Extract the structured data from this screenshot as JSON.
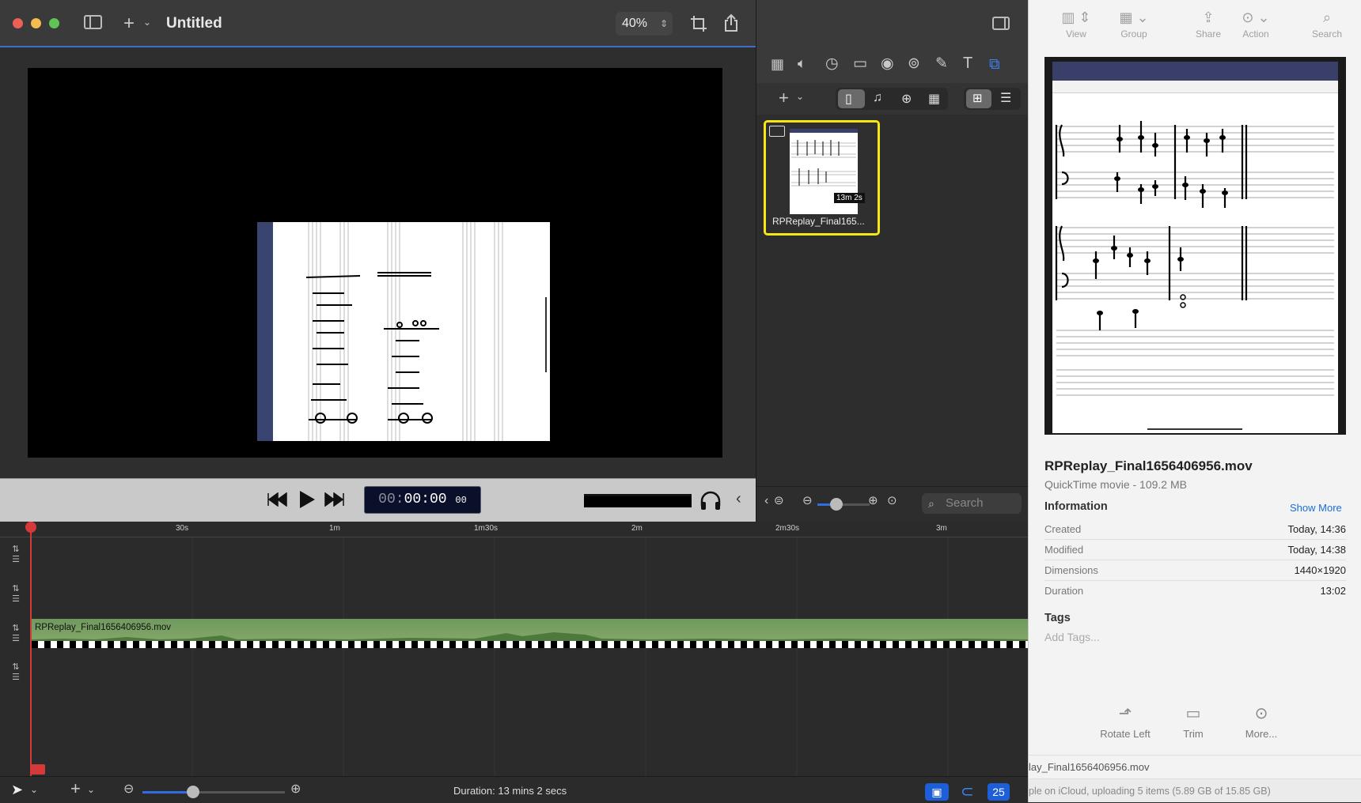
{
  "editor": {
    "title": "Untitled",
    "zoom": "40%",
    "timecode": {
      "dim": "00:",
      "main": "00:00",
      "frames": "00"
    },
    "icons": [
      "close-button",
      "minimize-button",
      "maximize-button",
      "sidebar-icon",
      "add-icon",
      "crop-icon",
      "share-icon"
    ]
  },
  "library": {
    "thumbnail": {
      "name": "RPReplay_Final165...",
      "duration": "13m 2s"
    },
    "search_placeholder": "Search"
  },
  "timeline": {
    "ticks": [
      "30s",
      "1m",
      "1m30s",
      "2m",
      "2m30s",
      "3m"
    ],
    "clip_label": "RPReplay_Final1656406956.mov",
    "duration": "Duration: 13 mins 2 secs",
    "fps_badge": "25"
  },
  "finder": {
    "toolbar": {
      "view": "View",
      "group": "Group",
      "share": "Share",
      "action": "Action",
      "search": "Search"
    },
    "filename": "RPReplay_Final1656406956.mov",
    "subtitle": "QuickTime movie - 109.2 MB",
    "info_heading": "Information",
    "show_more": "Show More",
    "info": [
      {
        "k": "Created",
        "v": "Today, 14:36"
      },
      {
        "k": "Modified",
        "v": "Today, 14:38"
      },
      {
        "k": "Dimensions",
        "v": "1440×1920"
      },
      {
        "k": "Duration",
        "v": "13:02"
      }
    ],
    "tags_heading": "Tags",
    "tags_placeholder": "Add Tags...",
    "actions": {
      "rotate": "Rotate Left",
      "trim": "Trim",
      "more": "More..."
    },
    "path": "lay_Final1656406956.mov",
    "status": "ple on iCloud, uploading 5 items (5.89 GB of 15.85 GB)"
  }
}
